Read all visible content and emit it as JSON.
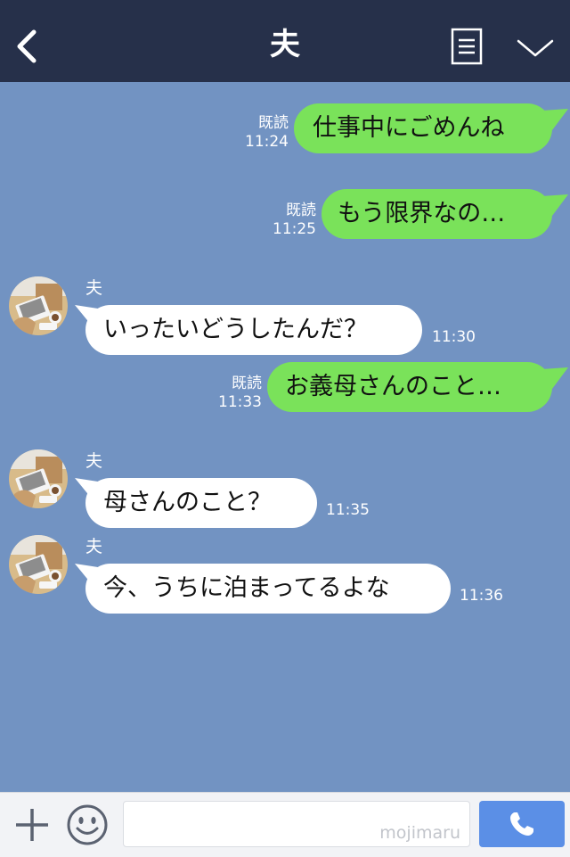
{
  "header": {
    "title": "夫"
  },
  "messages": [
    {
      "text": "仕事中にごめんね",
      "read": "既読",
      "time": "11:24"
    },
    {
      "text": "もう限界なの…",
      "read": "既読",
      "time": "11:25"
    },
    {
      "sender": "夫",
      "text": "いったいどうしたんだ？",
      "time": "11:30"
    },
    {
      "text": "お義母さんのこと…",
      "read": "既読",
      "time": "11:33"
    },
    {
      "sender": "夫",
      "text": "母さんのこと？",
      "time": "11:35"
    },
    {
      "sender": "夫",
      "text": "今、うちに泊まってるよな",
      "time": "11:36"
    }
  ],
  "input": {
    "placeholder": "",
    "watermark": "mojimaru"
  },
  "colors": {
    "header_bg": "#26304a",
    "chat_bg": "#7293c2",
    "outgoing_bubble": "#7ae25a",
    "incoming_bubble": "#ffffff",
    "call_button": "#5b8fe6"
  },
  "icons": [
    "back-icon",
    "menu-icon",
    "chevron-down-icon",
    "plus-icon",
    "smile-icon",
    "phone-icon"
  ]
}
